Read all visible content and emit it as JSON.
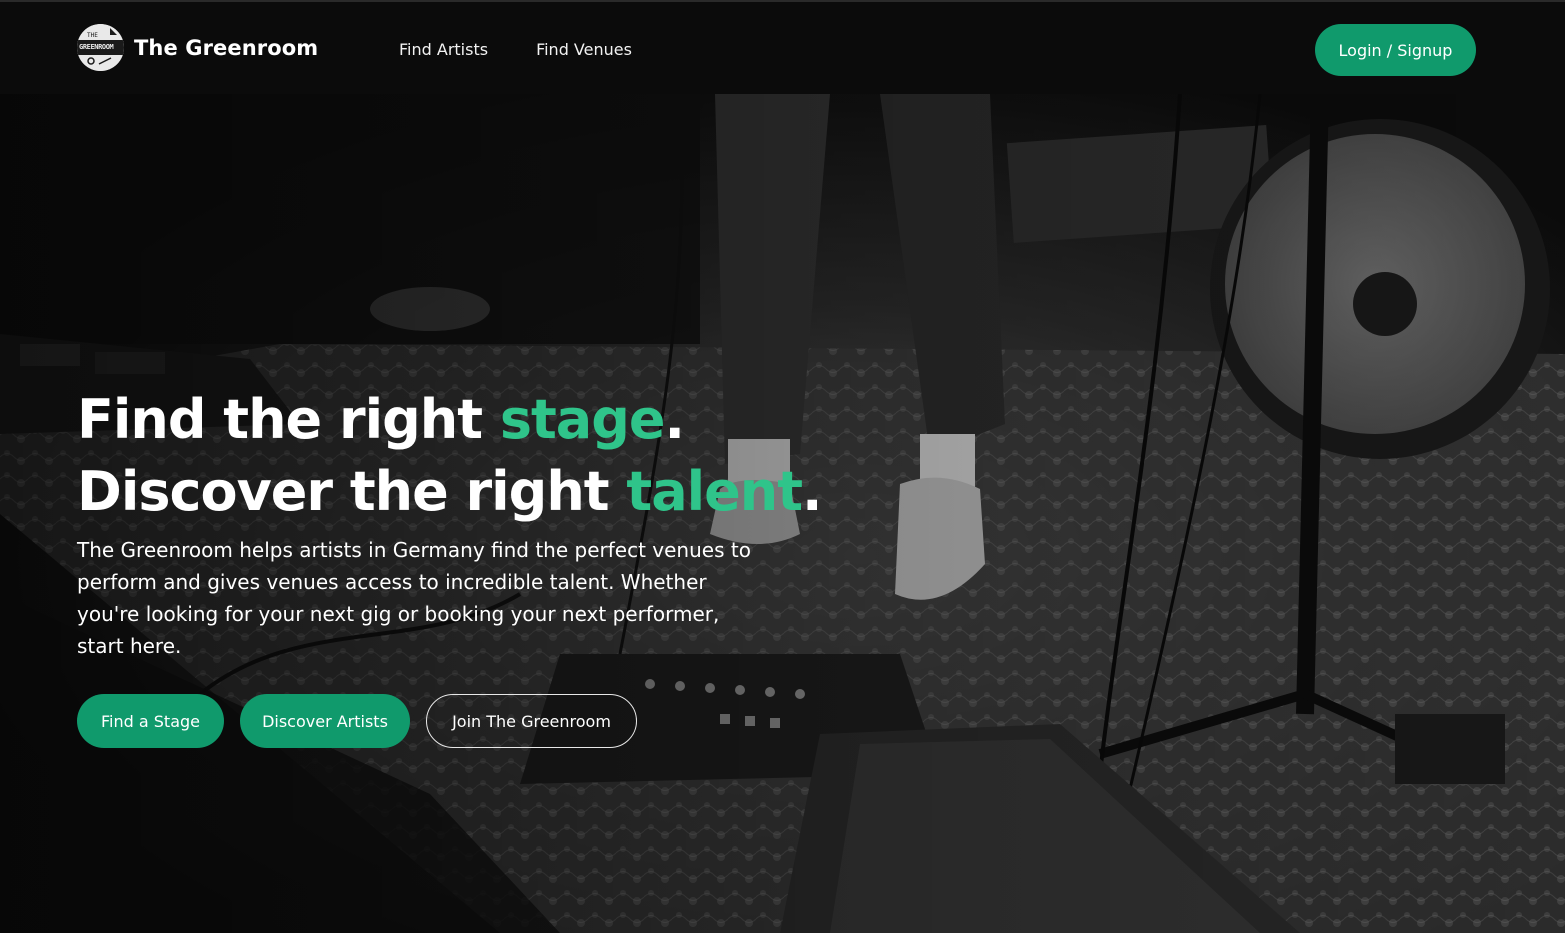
{
  "brand": {
    "name": "The Greenroom",
    "logo_top": "THE",
    "logo_main": "GREENROOM"
  },
  "nav": {
    "links": [
      {
        "label": "Find Artists"
      },
      {
        "label": "Find Venues"
      }
    ],
    "login_label": "Login / Signup"
  },
  "hero": {
    "line1_prefix": "Find the right ",
    "line1_accent": "stage",
    "line1_suffix": ".",
    "line2_prefix": "Discover the right ",
    "line2_accent": "talent",
    "line2_suffix": ".",
    "description": "The Greenroom helps artists in Germany find the perfect venues to perform and gives venues access to incredible talent. Whether you're looking for your next gig or booking your next performer, start here.",
    "buttons": [
      {
        "label": "Find a Stage"
      },
      {
        "label": "Discover Artists"
      },
      {
        "label": "Join The Greenroom"
      }
    ]
  },
  "colors": {
    "accent": "#2fc48a",
    "button_green": "#109a6c",
    "nav_bg": "#0b0b0b"
  }
}
